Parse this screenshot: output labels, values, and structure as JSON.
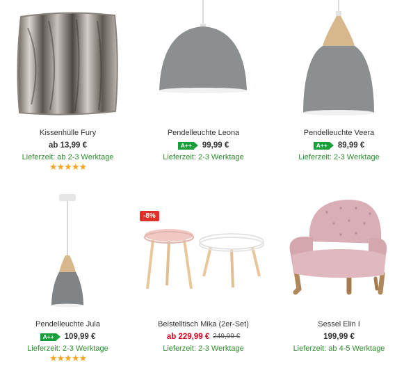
{
  "products": [
    {
      "name": "Kissenhülle Fury",
      "price": "ab 13,99 €",
      "energy": "",
      "old_price": "",
      "delivery": "Lieferzeit: ab 2-3 Werktage",
      "stars": "★★★★★",
      "badge": ""
    },
    {
      "name": "Pendelleuchte Leona",
      "price": "99,99 €",
      "energy": "A++",
      "old_price": "",
      "delivery": "Lieferzeit: 2-3 Werktage",
      "stars": "",
      "badge": ""
    },
    {
      "name": "Pendelleuchte Veera",
      "price": "89,99 €",
      "energy": "A++",
      "old_price": "",
      "delivery": "Lieferzeit: 2-3 Werktage",
      "stars": "",
      "badge": ""
    },
    {
      "name": "Pendelleuchte Jula",
      "price": "109,99 €",
      "energy": "A++",
      "old_price": "",
      "delivery": "Lieferzeit: 2-3 Werktage",
      "stars": "★★★★★",
      "badge": ""
    },
    {
      "name": "Beistelltisch Mika (2er-Set)",
      "price": "ab 229,99 €",
      "energy": "",
      "old_price": "249,99 €",
      "delivery": "Lieferzeit: 2-3 Werktage",
      "stars": "",
      "badge": "-8%"
    },
    {
      "name": "Sessel Elin I",
      "price": "199,99 €",
      "energy": "",
      "old_price": "",
      "delivery": "Lieferzeit: ab 4-5 Werktage",
      "stars": "",
      "badge": ""
    }
  ],
  "colors": {
    "delivery": "#2e8b2e",
    "energy": "#17a03a",
    "sale": "#d0021b",
    "stars": "#f5a623",
    "badge": "#e0302a"
  }
}
